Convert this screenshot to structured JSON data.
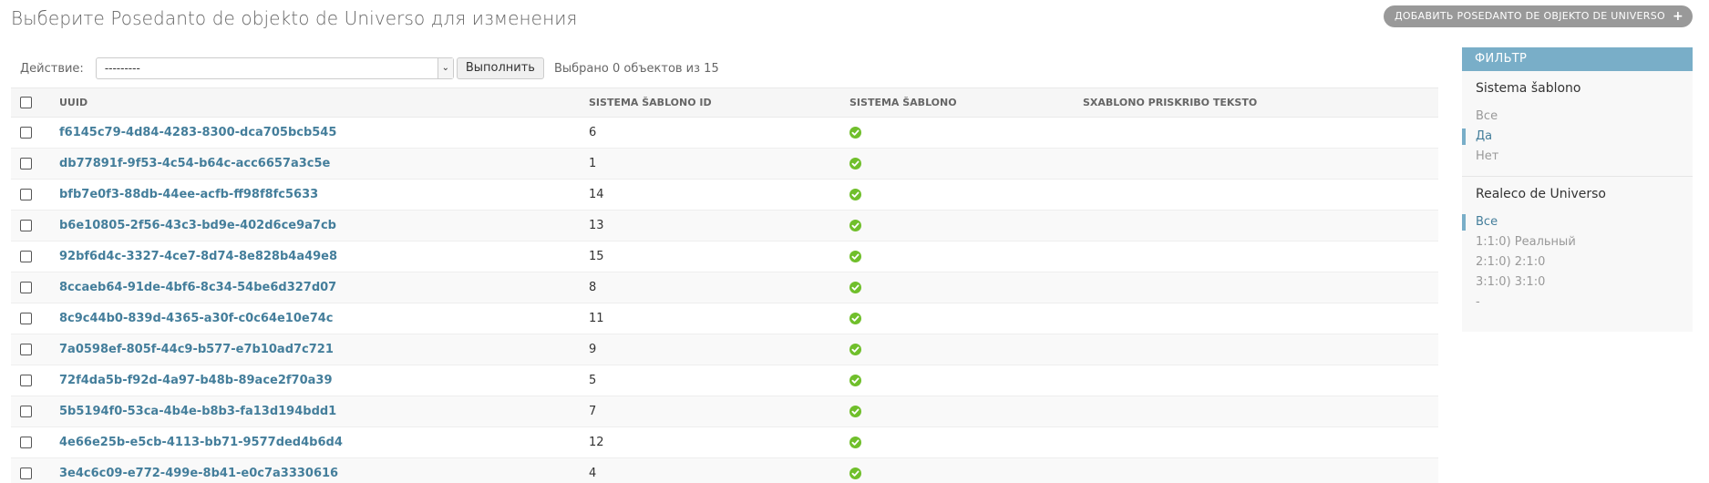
{
  "header": {
    "title": "Выберите Posedanto de objekto de Universo для изменения",
    "add_label": "ДОБАВИТЬ POSEDANTO DE OBJEKTO DE UNIVERSO",
    "add_icon": "plus-icon"
  },
  "actions": {
    "label": "Действие:",
    "selected_option": "---------",
    "go_label": "Выполнить",
    "counter": "Выбрано 0 объектов из 15"
  },
  "table": {
    "columns": [
      "UUID",
      "SISTEMA ŠABLONO ID",
      "SISTEMA ŠABLONO",
      "SXABLONO PRISKRIBO TEKSTO"
    ],
    "rows": [
      {
        "uuid": "f6145c79-4d84-4283-8300-dca705bcb545",
        "id": "6",
        "sablono": true,
        "teksto": ""
      },
      {
        "uuid": "db77891f-9f53-4c54-b64c-acc6657a3c5e",
        "id": "1",
        "sablono": true,
        "teksto": ""
      },
      {
        "uuid": "bfb7e0f3-88db-44ee-acfb-ff98f8fc5633",
        "id": "14",
        "sablono": true,
        "teksto": ""
      },
      {
        "uuid": "b6e10805-2f56-43c3-bd9e-402d6ce9a7cb",
        "id": "13",
        "sablono": true,
        "teksto": ""
      },
      {
        "uuid": "92bf6d4c-3327-4ce7-8d74-8e828b4a49e8",
        "id": "15",
        "sablono": true,
        "teksto": ""
      },
      {
        "uuid": "8ccaeb64-91de-4bf6-8c34-54be6d327d07",
        "id": "8",
        "sablono": true,
        "teksto": ""
      },
      {
        "uuid": "8c9c44b0-839d-4365-a30f-c0c64e10e74c",
        "id": "11",
        "sablono": true,
        "teksto": ""
      },
      {
        "uuid": "7a0598ef-805f-44c9-b577-e7b10ad7c721",
        "id": "9",
        "sablono": true,
        "teksto": ""
      },
      {
        "uuid": "72f4da5b-f92d-4a97-b48b-89ace2f70a39",
        "id": "5",
        "sablono": true,
        "teksto": ""
      },
      {
        "uuid": "5b5194f0-53ca-4b4e-b8b3-fa13d194bdd1",
        "id": "7",
        "sablono": true,
        "teksto": ""
      },
      {
        "uuid": "4e66e25b-e5cb-4113-bb71-9577ded4b6d4",
        "id": "12",
        "sablono": true,
        "teksto": ""
      },
      {
        "uuid": "3e4c6c09-e772-499e-8b41-e0c7a3330616",
        "id": "4",
        "sablono": true,
        "teksto": ""
      }
    ]
  },
  "filter": {
    "title": "ФИЛЬТР",
    "groups": [
      {
        "title": "Sistema šablono",
        "items": [
          {
            "label": "Все",
            "selected": false
          },
          {
            "label": "Да",
            "selected": true
          },
          {
            "label": "Нет",
            "selected": false
          }
        ]
      },
      {
        "title": "Realeco de Universo",
        "items": [
          {
            "label": "Все",
            "selected": true
          },
          {
            "label": "1:1:0) Реальный",
            "selected": false
          },
          {
            "label": "2:1:0) 2:1:0",
            "selected": false
          },
          {
            "label": "3:1:0) 3:1:0",
            "selected": false
          },
          {
            "label": "-",
            "selected": false
          }
        ]
      }
    ]
  },
  "colors": {
    "link": "#447e9b",
    "filter_header": "#79aec8",
    "ok_icon": "#70bf2b"
  }
}
